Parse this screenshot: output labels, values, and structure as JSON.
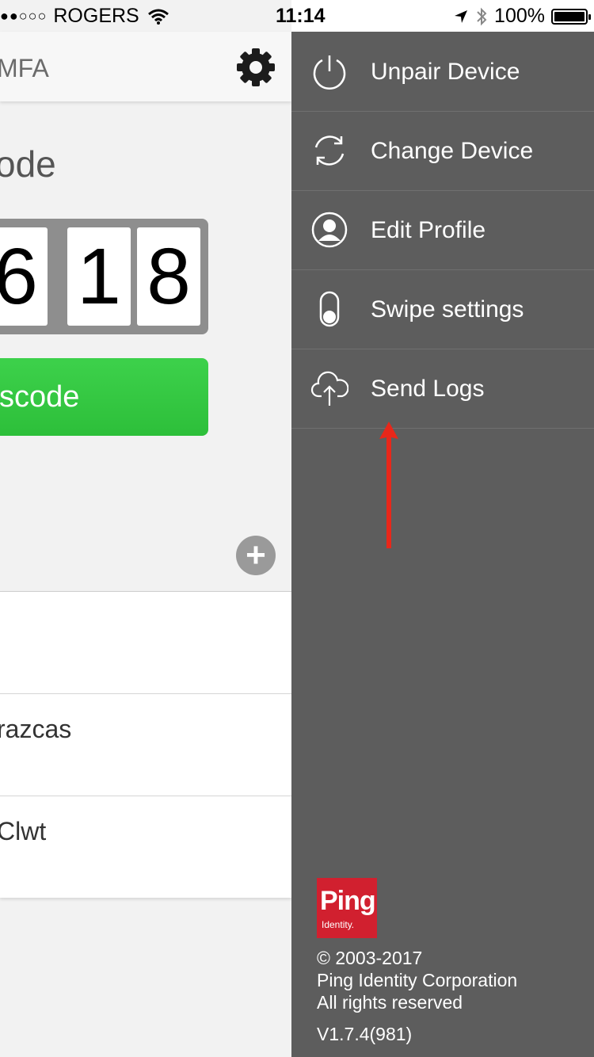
{
  "status_bar": {
    "signal": "●●○○○",
    "carrier": "ROGERS",
    "time": "11:14",
    "battery": "100%",
    "battery_level": 1.0
  },
  "main": {
    "nav_title": "MFA",
    "passcode_heading": "ode",
    "digits": [
      "6",
      "1",
      "8"
    ],
    "generate_button": "sscode",
    "list_rows": [
      "",
      "razcas",
      "Clwt"
    ]
  },
  "drawer": {
    "items": [
      {
        "label": "Unpair Device",
        "icon": "power-icon"
      },
      {
        "label": "Change Device",
        "icon": "refresh-icon"
      },
      {
        "label": "Edit Profile",
        "icon": "profile-icon"
      },
      {
        "label": "Swipe settings",
        "icon": "toggle-icon"
      },
      {
        "label": "Send Logs",
        "icon": "cloud-upload-icon"
      }
    ],
    "logo": {
      "word": "Ping",
      "sub": "Identity."
    },
    "footer": {
      "copyright": "© 2003-2017",
      "company": "Ping Identity Corporation",
      "rights": "All rights reserved",
      "version": "V1.7.4(981)"
    }
  },
  "colors": {
    "drawer_bg": "#5d5d5d",
    "green": "#34c83f",
    "ping_red": "#d1202f",
    "arrow_red": "#e8271a"
  }
}
